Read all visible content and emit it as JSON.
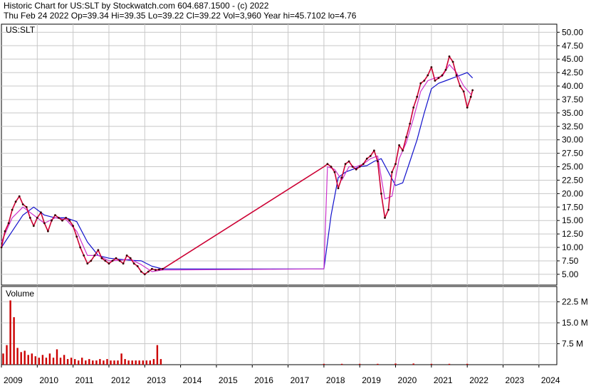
{
  "header": {
    "line1": "Historic Chart for US:SLT by Stockwatch.com 604.687.1500 - (c) 2022",
    "line2": "Thu Feb 24 2022   Op=39.34   Hi=39.35   Lo=39.22   Cl=39.22   Vol=3,960   Year hi=45.7102   lo=4.76"
  },
  "chart_data": {
    "type": "line",
    "symbol_label": "US:SLT",
    "volume_label": "Volume",
    "price_axis": {
      "range": [
        3.0,
        51.5
      ],
      "ticks": [
        "5.00",
        "7.50",
        "10.00",
        "12.50",
        "15.00",
        "17.50",
        "20.00",
        "22.50",
        "25.00",
        "27.50",
        "30.00",
        "32.50",
        "35.00",
        "37.50",
        "40.00",
        "42.50",
        "45.00",
        "47.50",
        "50.00"
      ],
      "tick_values": [
        5,
        7.5,
        10,
        12.5,
        15,
        17.5,
        20,
        22.5,
        25,
        27.5,
        30,
        32.5,
        35,
        37.5,
        40,
        42.5,
        45,
        47.5,
        50
      ],
      "grid": true
    },
    "volume_axis": {
      "range": [
        0,
        28
      ],
      "ticks": [
        "7.5 M",
        "15.0 M",
        "22.5 M"
      ],
      "tick_values": [
        7.5,
        15,
        22.5
      ],
      "unit": "M"
    },
    "x_axis": {
      "range": [
        2009.0,
        2024.5
      ],
      "labels": [
        "2009",
        "2010",
        "2011",
        "2012",
        "2013",
        "2014",
        "2015",
        "2016",
        "2017",
        "2018",
        "2019",
        "2020",
        "2021",
        "2022",
        "2023",
        "2024"
      ],
      "label_values": [
        2009,
        2010,
        2011,
        2012,
        2013,
        2014,
        2015,
        2016,
        2017,
        2018,
        2019,
        2020,
        2021,
        2022,
        2023,
        2024
      ]
    },
    "series": [
      {
        "key": "price",
        "color": "#cc0033",
        "x": [
          2009.0,
          2009.1,
          2009.2,
          2009.3,
          2009.4,
          2009.5,
          2009.6,
          2009.7,
          2009.8,
          2009.9,
          2010.0,
          2010.1,
          2010.2,
          2010.3,
          2010.4,
          2010.5,
          2010.6,
          2010.7,
          2010.8,
          2010.9,
          2011.0,
          2011.1,
          2011.2,
          2011.3,
          2011.4,
          2011.5,
          2011.6,
          2011.7,
          2011.8,
          2011.9,
          2012.0,
          2012.1,
          2012.2,
          2012.3,
          2012.4,
          2012.5,
          2012.6,
          2012.7,
          2012.8,
          2012.9,
          2013.0,
          2013.1,
          2013.2,
          2013.3,
          2013.4,
          2013.5,
          2018.0,
          2018.1,
          2018.2,
          2018.3,
          2018.4,
          2018.5,
          2018.6,
          2018.7,
          2018.8,
          2018.9,
          2019.0,
          2019.1,
          2019.2,
          2019.3,
          2019.4,
          2019.5,
          2019.6,
          2019.7,
          2019.8,
          2019.9,
          2020.0,
          2020.1,
          2020.2,
          2020.3,
          2020.4,
          2020.5,
          2020.6,
          2020.7,
          2020.8,
          2020.9,
          2021.0,
          2021.1,
          2021.2,
          2021.3,
          2021.4,
          2021.5,
          2021.6,
          2021.7,
          2021.8,
          2021.9,
          2022.0,
          2022.1,
          2022.15
        ],
        "y": [
          10.0,
          13.0,
          14.5,
          17.0,
          18.5,
          19.5,
          18.0,
          17.5,
          15.5,
          14.0,
          15.5,
          16.5,
          14.5,
          13.0,
          15.0,
          16.0,
          15.5,
          15.0,
          15.5,
          15.0,
          14.0,
          12.0,
          10.0,
          8.5,
          7.0,
          7.5,
          8.5,
          9.5,
          8.0,
          7.5,
          7.0,
          7.5,
          8.0,
          7.5,
          7.0,
          8.5,
          8.0,
          7.0,
          6.5,
          5.5,
          5.0,
          5.5,
          6.0,
          5.8,
          5.9,
          6.0,
          25.0,
          25.5,
          25.0,
          24.0,
          21.0,
          23.0,
          25.5,
          26.0,
          25.0,
          24.5,
          25.0,
          25.5,
          26.5,
          27.0,
          28.0,
          26.0,
          20.0,
          15.5,
          17.0,
          24.0,
          25.5,
          29.0,
          28.0,
          30.5,
          33.0,
          36.0,
          38.0,
          40.5,
          41.0,
          42.0,
          43.5,
          41.0,
          41.5,
          42.0,
          43.0,
          45.5,
          44.5,
          42.0,
          40.0,
          39.0,
          36.0,
          38.0,
          39.22
        ]
      },
      {
        "key": "ma_short",
        "color": "#cc33cc",
        "x": [
          2009.0,
          2009.3,
          2009.6,
          2009.9,
          2010.2,
          2010.5,
          2010.8,
          2011.1,
          2011.4,
          2011.7,
          2012.0,
          2012.3,
          2012.6,
          2012.9,
          2013.2,
          2013.5,
          2018.0,
          2018.1,
          2018.3,
          2018.5,
          2018.7,
          2018.9,
          2019.1,
          2019.3,
          2019.5,
          2019.7,
          2019.9,
          2020.1,
          2020.3,
          2020.5,
          2020.7,
          2020.9,
          2021.1,
          2021.3,
          2021.5,
          2021.7,
          2021.9,
          2022.1
        ],
        "y": [
          11.0,
          15.5,
          17.5,
          16.0,
          14.5,
          15.5,
          15.2,
          13.0,
          8.5,
          8.5,
          7.5,
          7.6,
          7.8,
          6.8,
          5.5,
          5.8,
          6.0,
          25.0,
          24.5,
          22.5,
          25.0,
          25.0,
          25.5,
          26.5,
          27.0,
          19.0,
          19.5,
          26.5,
          29.5,
          34.0,
          39.0,
          41.0,
          41.5,
          41.8,
          44.0,
          42.5,
          40.0,
          38.5
        ]
      },
      {
        "key": "ma_long",
        "color": "#1111cc",
        "x": [
          2009.0,
          2009.3,
          2009.6,
          2009.9,
          2010.2,
          2010.5,
          2010.8,
          2011.1,
          2011.4,
          2011.7,
          2012.0,
          2012.3,
          2012.6,
          2012.9,
          2013.2,
          2013.5,
          2018.0,
          2018.2,
          2018.4,
          2018.6,
          2018.8,
          2019.0,
          2019.2,
          2019.4,
          2019.6,
          2019.8,
          2020.0,
          2020.2,
          2020.4,
          2020.6,
          2020.8,
          2021.0,
          2021.2,
          2021.4,
          2021.6,
          2021.8,
          2022.0,
          2022.15
        ],
        "y": [
          10.0,
          13.0,
          16.0,
          17.5,
          16.0,
          15.5,
          15.5,
          14.8,
          11.0,
          8.5,
          8.0,
          7.8,
          7.6,
          7.5,
          6.5,
          6.0,
          6.0,
          16.0,
          23.0,
          24.0,
          24.5,
          25.0,
          25.2,
          26.0,
          26.5,
          24.0,
          21.5,
          22.0,
          26.0,
          30.0,
          35.0,
          39.5,
          40.5,
          41.0,
          41.5,
          42.0,
          42.5,
          41.5
        ]
      }
    ],
    "volume_bars": {
      "color": "#cc0000",
      "x": [
        2009.05,
        2009.15,
        2009.25,
        2009.35,
        2009.45,
        2009.55,
        2009.65,
        2009.75,
        2009.85,
        2009.95,
        2010.05,
        2010.15,
        2010.25,
        2010.35,
        2010.45,
        2010.55,
        2010.65,
        2010.75,
        2010.85,
        2010.95,
        2011.05,
        2011.15,
        2011.25,
        2011.35,
        2011.45,
        2011.55,
        2011.65,
        2011.75,
        2011.85,
        2011.95,
        2012.05,
        2012.15,
        2012.25,
        2012.35,
        2012.45,
        2012.55,
        2012.65,
        2012.75,
        2012.85,
        2012.95,
        2013.05,
        2013.15,
        2013.25,
        2013.35,
        2013.45
      ],
      "values": [
        4.0,
        7.0,
        23.0,
        17.0,
        6.0,
        4.5,
        5.0,
        3.5,
        4.0,
        3.0,
        2.5,
        3.5,
        2.5,
        4.0,
        2.5,
        5.5,
        2.5,
        3.5,
        2.0,
        2.5,
        2.0,
        1.5,
        2.5,
        1.5,
        2.0,
        1.5,
        1.5,
        2.0,
        1.5,
        2.0,
        1.5,
        1.5,
        1.5,
        4.0,
        2.0,
        1.5,
        1.5,
        1.5,
        1.5,
        1.5,
        1.5,
        1.5,
        2.0,
        7.0,
        2.0
      ],
      "x2": [
        2018.0,
        2018.5,
        2019.0,
        2019.5,
        2020.0,
        2020.5,
        2021.0,
        2021.5,
        2022.0
      ],
      "values2": [
        0.3,
        0.3,
        0.3,
        0.3,
        0.4,
        0.4,
        0.3,
        0.3,
        0.3
      ]
    }
  }
}
